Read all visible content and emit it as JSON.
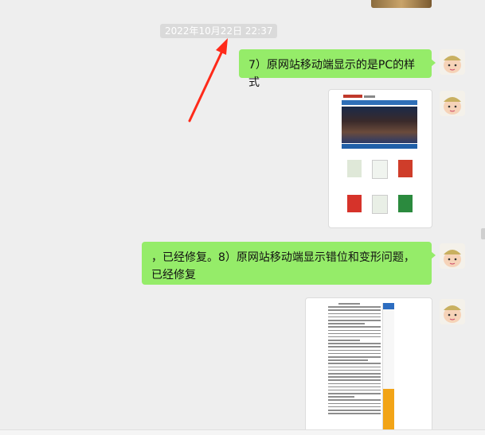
{
  "chat": {
    "timestamp": "2022年10月22日 22:37",
    "messages": [
      {
        "type": "text",
        "text": "7）原网站移动端显示的是PC的样式"
      },
      {
        "type": "image",
        "description_icon": "website-screenshot"
      },
      {
        "type": "text",
        "text": "，已经修复。8）原网站移动端显示错位和变形问题，已经修复"
      },
      {
        "type": "image",
        "description_icon": "document-screenshot"
      }
    ]
  },
  "colors": {
    "bubble": "#95ec69",
    "background": "#eeeeee",
    "annotation_arrow": "#ff2a1a"
  }
}
